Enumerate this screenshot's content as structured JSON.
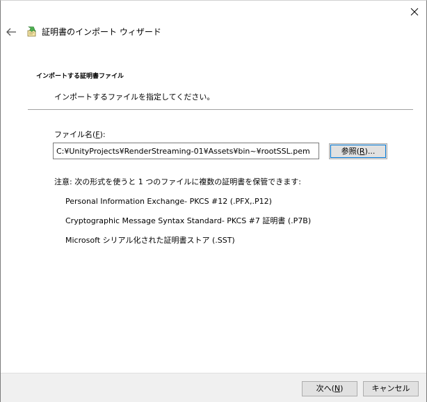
{
  "window": {
    "close_glyph": "✕"
  },
  "header": {
    "back_icon": "back-arrow-icon",
    "wizard_icon": "certificate-import-icon",
    "title": "証明書のインポート ウィザード"
  },
  "section": {
    "heading": "インポートする証明書ファイル",
    "description": "インポートするファイルを指定してください。"
  },
  "file": {
    "label_prefix": "ファイル名(",
    "label_accel": "F",
    "label_suffix": "):",
    "value": "C:¥UnityProjects¥RenderStreaming-01¥Assets¥bin~¥rootSSL.pem",
    "browse_prefix": "参照(",
    "browse_accel": "R",
    "browse_suffix": ")..."
  },
  "note": "注意: 次の形式を使うと 1 つのファイルに複数の証明書を保管できます:",
  "formats": [
    "Personal Information Exchange- PKCS #12 (.PFX,.P12)",
    "Cryptographic Message Syntax Standard- PKCS #7 証明書 (.P7B)",
    "Microsoft シリアル化された証明書ストア (.SST)"
  ],
  "footer": {
    "next_prefix": "次へ(",
    "next_accel": "N",
    "next_suffix": ")",
    "cancel_label": "キャンセル"
  },
  "colors": {
    "focus_ring": "#0078d7",
    "button_face": "#e1e1e1",
    "footer_bg": "#f0f0f0",
    "icon_green": "#4caf50"
  }
}
